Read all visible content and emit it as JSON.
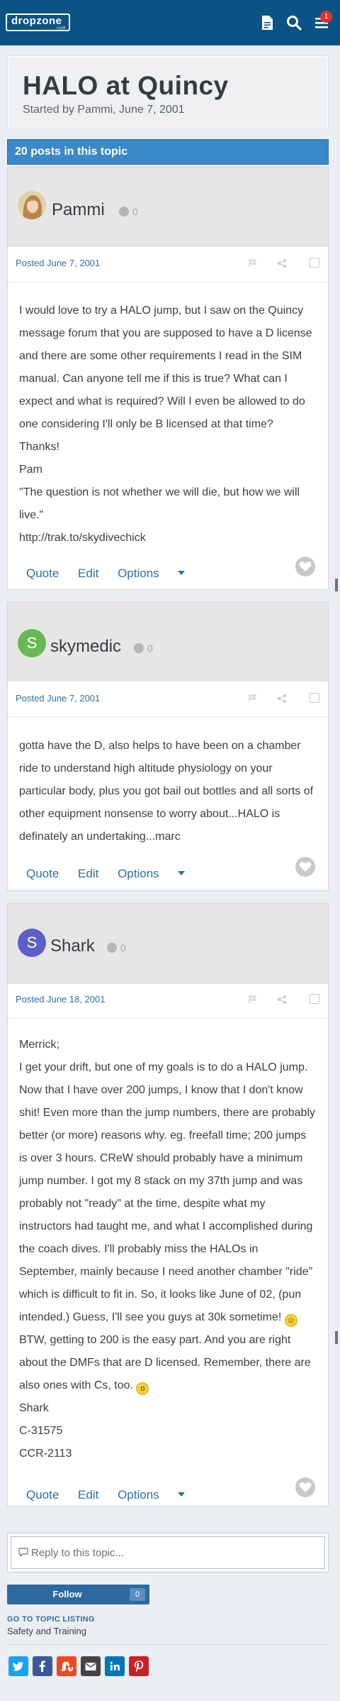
{
  "header": {
    "logo_text": "dropzone",
    "logo_sub": ".com",
    "notification_count": "1",
    "icons": [
      "document-icon",
      "search-icon",
      "menu-icon"
    ],
    "bar_color": "#0b5384"
  },
  "topic": {
    "title": "HALO at Quincy",
    "started_by": "Started by Pammi, June 7, 2001",
    "post_count": "20 posts in this topic"
  },
  "posts": [
    {
      "author": "Pammi",
      "reputation": "0",
      "posted": "Posted June 7, 2001",
      "avatar_letter": "",
      "avatar_color": "#c9a26a",
      "body": [
        "I would love to try a HALO jump, but I saw on the Quincy message forum that you are supposed to have a D license and there are some other requirements I read in the SIM manual. Can anyone tell me if this is true? What can I expect and what is required? Will I even be allowed to do one considering I'll only be B licensed at that time?",
        "Thanks!",
        "Pam",
        "\"The question is not whether we will die, but how we will live.\"",
        "http://trak.to/skydivechick"
      ]
    },
    {
      "author": "skymedic",
      "reputation": "0",
      "posted": "Posted June 7, 2001",
      "avatar_letter": "S",
      "avatar_color": "#6ab854",
      "body": [
        "gotta have the D, also helps to have been on a chamber ride to understand high altitude physiology on your particular body, plus you got bail out bottles and all sorts of other equipment nonsense to worry about...HALO is definately an undertaking...marc"
      ]
    },
    {
      "author": "Shark",
      "reputation": "0",
      "posted": "Posted June 18, 2001",
      "avatar_letter": "S",
      "avatar_color": "#5b5fc7",
      "body": [
        "Merrick;",
        "I get your drift, but one of my goals is to do a HALO jump. Now that I have over 200 jumps, I know that I don't know shit! Even more than the jump numbers, there are probably better (or more) reasons why. eg. freefall time; 200 jumps is over 3 hours. CReW should probably have a minimum jump number. I got my 8 stack on my 37th jump and was probably not \"ready\" at the time, despite what my instructors had taught me, and what I accomplished during the coach dives. I'll probably miss the HALOs in September, mainly because I need another chamber \"ride\" which is difficult to fit in. So, it looks like June of 02, (pun intended.) Guess, I'll see you guys at 30k sometime!",
        "BTW, getting to 200 is the easy part. And you are right about the DMFs that are D licensed. Remember, there are also ones with Cs, too.",
        "Shark",
        "C-31575",
        "CCR-2113"
      ]
    }
  ],
  "post_actions": {
    "quote": "Quote",
    "edit": "Edit",
    "options": "Options"
  },
  "footer": {
    "reply_placeholder": "Reply to this topic...",
    "follow_label": "Follow",
    "follow_count": "0",
    "goto_listing": "GO TO TOPIC LISTING",
    "goto_sub": "Safety and Training",
    "share_buttons": [
      {
        "name": "twitter",
        "glyph": "t",
        "color": "#1da1f2"
      },
      {
        "name": "facebook",
        "glyph": "f",
        "color": "#3b5998"
      },
      {
        "name": "stumbleupon",
        "glyph": "su",
        "color": "#eb4924"
      },
      {
        "name": "email",
        "glyph": "✉",
        "color": "#444444"
      },
      {
        "name": "linkedin",
        "glyph": "in",
        "color": "#0077b5"
      },
      {
        "name": "pinterest",
        "glyph": "p",
        "color": "#cb2027"
      }
    ]
  }
}
